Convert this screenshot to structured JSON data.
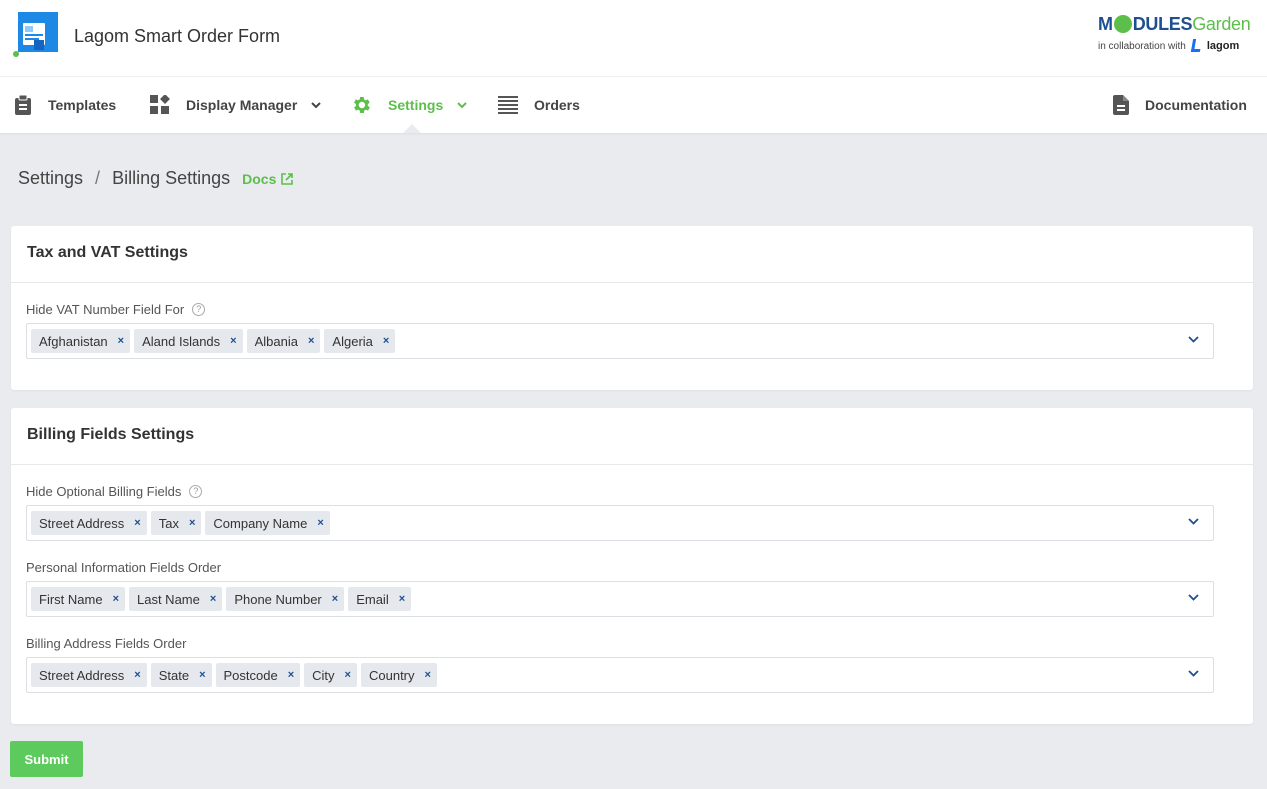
{
  "header": {
    "app_title": "Lagom Smart Order Form",
    "brand_modules_m": "M",
    "brand_modules_rest": "DULES",
    "brand_garden": "Garden",
    "brand_collab": "in collaboration with",
    "brand_lagom": "lagom"
  },
  "nav": {
    "templates": "Templates",
    "display_manager": "Display Manager",
    "settings": "Settings",
    "orders": "Orders",
    "documentation": "Documentation"
  },
  "breadcrumb": {
    "parent": "Settings",
    "separator": "/",
    "current": "Billing Settings",
    "docs": "Docs"
  },
  "tax_panel": {
    "title": "Tax and VAT Settings",
    "hide_vat_label": "Hide VAT Number Field For",
    "hide_vat_values": [
      "Afghanistan",
      "Aland Islands",
      "Albania",
      "Algeria"
    ]
  },
  "billing_panel": {
    "title": "Billing Fields Settings",
    "hide_optional_label": "Hide Optional Billing Fields",
    "hide_optional_values": [
      "Street Address",
      "Tax",
      "Company Name"
    ],
    "personal_order_label": "Personal Information Fields Order",
    "personal_order_values": [
      "First Name",
      "Last Name",
      "Phone Number",
      "Email"
    ],
    "address_order_label": "Billing Address Fields Order",
    "address_order_values": [
      "Street Address",
      "State",
      "Postcode",
      "City",
      "Country"
    ]
  },
  "tag_remove_glyph": "×",
  "help_glyph": "?",
  "submit_label": "Submit",
  "colors": {
    "accent_green": "#5cbf4a",
    "submit_green": "#5cca5c",
    "brand_blue": "#1e4f91",
    "background": "#e9ebef"
  }
}
